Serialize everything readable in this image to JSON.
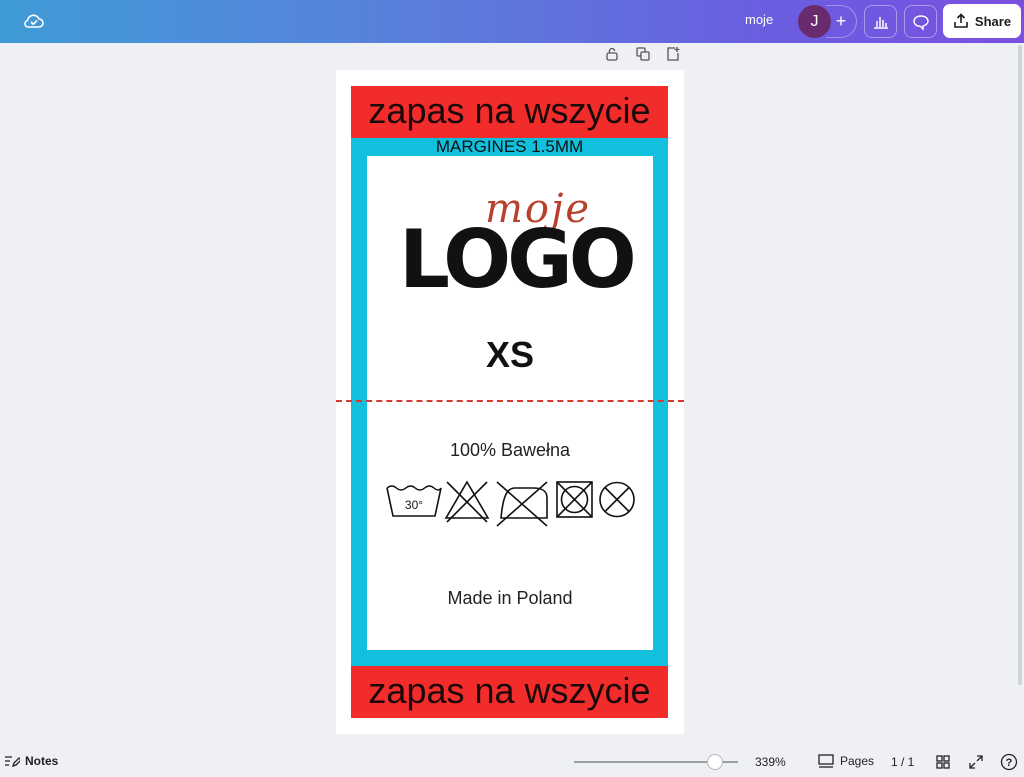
{
  "topbar": {
    "doc_title": "moje",
    "avatar_initial": "J",
    "add_label": "+",
    "share_label": "Share",
    "icons": [
      "cloud-check-icon",
      "insights-icon",
      "comment-icon",
      "share-upload-icon"
    ],
    "gradient": [
      "#3f9bd6",
      "#7b4fe0"
    ]
  },
  "page_controls": [
    "lock-icon",
    "duplicate-icon",
    "add-page-icon"
  ],
  "label": {
    "top_band": "zapas na wszycie",
    "margin_note": "MARGINES 1.5MM",
    "logo_script": "moje",
    "logo_text": "LOGO",
    "size": "XS",
    "material": "100% Bawełna",
    "wash_temp": "30°",
    "care_symbols": [
      "wash-30-icon",
      "no-bleach-icon",
      "no-iron-icon",
      "no-tumble-dry-icon",
      "no-dry-clean-icon"
    ],
    "made_in": "Made in Poland",
    "bottom_band": "zapas na wszycie",
    "colors": {
      "band": "#f22b2b",
      "frame": "#12c0de",
      "fold_line": "#d63a2f",
      "script": "#b8412d"
    }
  },
  "bottombar": {
    "notes_label": "Notes",
    "zoom_value": "339%",
    "zoom_fraction": 0.86,
    "pages_label": "Pages",
    "page_count": "1 / 1",
    "help_label": "?"
  }
}
